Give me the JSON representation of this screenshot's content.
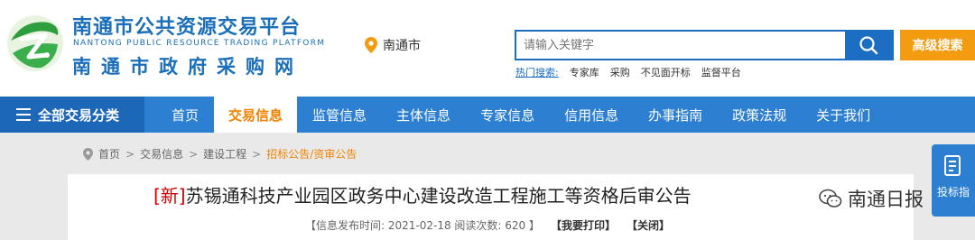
{
  "brand": {
    "title_cn": "南通市公共资源交易平台",
    "title_en": "NANTONG PUBLIC RESOURCE TRADING PLATFORM",
    "subtitle_cn": "南通市政府采购网",
    "logo_icon": "nantong-logo-icon"
  },
  "location": {
    "city": "南通市",
    "icon": "map-pin-icon"
  },
  "search": {
    "placeholder": "请输入关键字",
    "value": "",
    "button_icon": "search-icon",
    "advanced_label": "高级搜索",
    "hot_label": "热门搜索:",
    "hot_items": [
      "专家库",
      "采购",
      "不见面开标",
      "监督平台"
    ]
  },
  "nav": {
    "all_label": "全部交易分类",
    "items": [
      {
        "label": "首页",
        "active": false
      },
      {
        "label": "交易信息",
        "active": true
      },
      {
        "label": "监管信息",
        "active": false
      },
      {
        "label": "主体信息",
        "active": false
      },
      {
        "label": "专家信息",
        "active": false
      },
      {
        "label": "信用信息",
        "active": false
      },
      {
        "label": "办事指南",
        "active": false
      },
      {
        "label": "政策法规",
        "active": false
      },
      {
        "label": "关于我们",
        "active": false
      }
    ]
  },
  "breadcrumb": {
    "items": [
      "首页",
      "交易信息",
      "建设工程"
    ],
    "current": "招标公告/资审公告"
  },
  "article": {
    "tag": "[新]",
    "title": "苏锡通科技产业园区政务中心建设改造工程施工等资格后审公告",
    "meta": "【信息发布时间: 2021-02-18 阅读次数: 620 】",
    "print_label": "【我要打印】",
    "close_label": "【关闭】"
  },
  "watermark": {
    "text": "南通日报"
  },
  "side_widget": {
    "label": "投标指",
    "icon": "document-icon"
  },
  "colors": {
    "primary": "#1b6ec2",
    "nav": "#2d7fd1",
    "accent": "#f08300",
    "advanced": "#f39c12"
  }
}
